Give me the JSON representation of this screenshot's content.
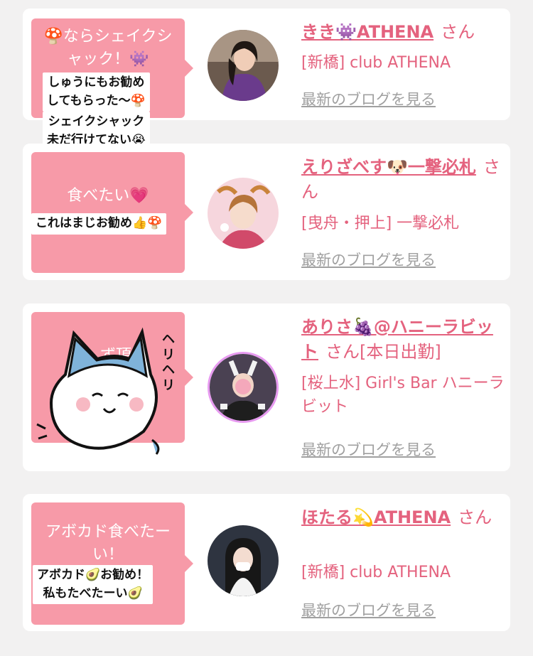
{
  "cards": [
    {
      "bubble_text": "🍄ならシェイクシャック！👾",
      "sticker": [
        "しゅうにもお勧め",
        "してもらった〜🍄",
        "シェイクシャック",
        "未だ行けてない😭"
      ],
      "name": "きき👾ATHENA",
      "honorific": "さん",
      "shop": "[新橋] club ATHENA",
      "blog_link": "最新のブログを見る"
    },
    {
      "bubble_text": "食べたい💗",
      "sticker": [
        "これはまじお勧め👍🍄"
      ],
      "name": "えりざべす🐶一撃必札",
      "honorific": "さん",
      "shop": "[曳舟・押上] 一撃必札",
      "blog_link": "最新のブログを見る"
    },
    {
      "bubble_text": "今…ず頂…",
      "sticker_hand": "ヘリヘリ",
      "name": "ありさ🍇@ハニーラビット",
      "honorific": "さん",
      "status": "[本日出勤]",
      "shop": "[桜上水] Girl's Bar ハニーラビット",
      "blog_link": "最新のブログを見る"
    },
    {
      "bubble_text": "アボカド食べたーい！",
      "sticker": [
        "アボカド🥑お勧め！",
        "私もたべたーい🥑"
      ],
      "name": "ほたる💫ATHENA",
      "honorific": "さん",
      "shop": "[新橋] club ATHENA",
      "blog_link": "最新のブログを見る"
    }
  ],
  "colors": {
    "pink": "#f79aa8",
    "name": "#e4627e",
    "link": "#a0a0a0",
    "bg": "#f2f1f1"
  }
}
